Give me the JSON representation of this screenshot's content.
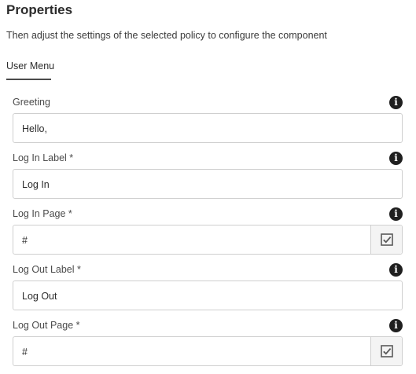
{
  "header": {
    "title": "Properties",
    "description": "Then adjust the settings of the selected policy to configure the component"
  },
  "tabs": [
    {
      "label": "User Menu",
      "active": true
    }
  ],
  "fields": [
    {
      "label": "Greeting",
      "value": "Hello,",
      "has_picker": false
    },
    {
      "label": "Log In Label *",
      "value": "Log In",
      "has_picker": false
    },
    {
      "label": "Log In Page *",
      "value": "#",
      "has_picker": true
    },
    {
      "label": "Log Out Label *",
      "value": "Log Out",
      "has_picker": false
    },
    {
      "label": "Log Out Page *",
      "value": "#",
      "has_picker": true
    }
  ],
  "icons": {
    "info": "info-icon",
    "picker": "checkbox-check-icon"
  },
  "colors": {
    "text": "#2c2c2c",
    "border": "#cfcfcf",
    "icon": "#1f1f1f",
    "tab_underline": "#4b4b4b"
  }
}
